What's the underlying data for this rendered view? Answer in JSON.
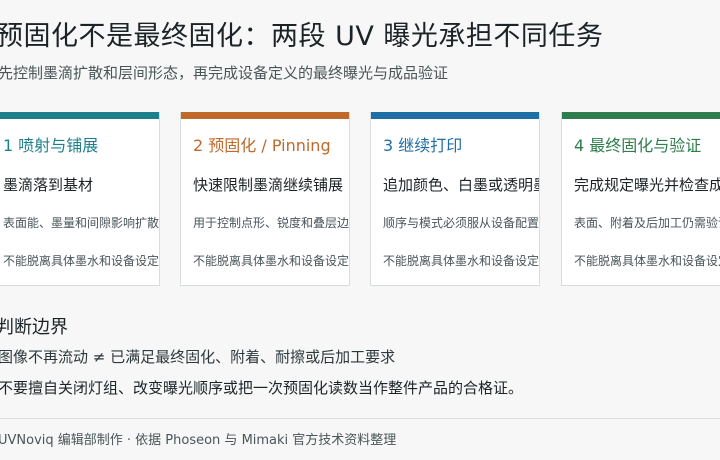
{
  "title": "预固化不是最终固化：两段 UV 曝光承担不同任务",
  "subtitle": "先控制墨滴扩散和层间形态，再完成设备定义的最终曝光与成品验证",
  "colors": {
    "teal": "#1e7f8c",
    "orange": "#c0692a",
    "blue": "#1f6fa7",
    "green": "#2f7d4e"
  },
  "cards": [
    {
      "step": "1  喷射与铺展",
      "head": "墨滴落到基材",
      "desc": "表面能、墨量和间隙影响扩散",
      "note": "不能脱离具体墨水和设备设定"
    },
    {
      "step": "2  预固化 / Pinning",
      "head": "快速限制墨滴继续铺展",
      "desc": "用于控制点形、锐度和叠层边界",
      "note": "不能脱离具体墨水和设备设定"
    },
    {
      "step": "3  继续打印",
      "head": "追加颜色、白墨或透明墨",
      "desc": "顺序与模式必须服从设备配置",
      "note": "不能脱离具体墨水和设备设定"
    },
    {
      "step": "4  最终固化与验证",
      "head": "完成规定曝光并检查成品",
      "desc": "表面、附着及后加工仍需验证",
      "note": "不能脱离具体墨水和设备设定"
    }
  ],
  "judgement": {
    "title": "判断边界",
    "line1": "图像不再流动 ≠ 已满足最终固化、附着、耐擦或后加工要求",
    "line2": "不要擅自关闭灯组、改变曝光顺序或把一次预固化读数当作整件产品的合格证。"
  },
  "footer": "UVNoviq 编辑部制作 · 依据 Phoseon 与 Mimaki 官方技术资料整理"
}
